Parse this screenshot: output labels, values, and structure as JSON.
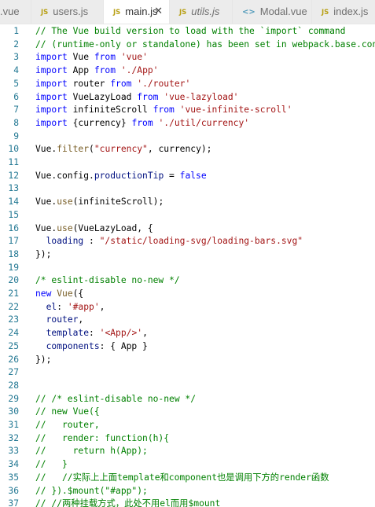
{
  "tabs": [
    {
      "label": ".vue",
      "icon": "vue",
      "active": false
    },
    {
      "label": "users.js",
      "icon": "JS",
      "active": false
    },
    {
      "label": "main.js",
      "icon": "JS",
      "active": true
    },
    {
      "label": "utils.js",
      "icon": "JS",
      "active": false
    },
    {
      "label": "Modal.vue",
      "icon": "vue",
      "active": false
    },
    {
      "label": "index.js",
      "icon": "JS",
      "active": false
    }
  ],
  "editor": {
    "lines": [
      {
        "n": "1",
        "tokens": [
          {
            "t": "// The Vue build version to load with the `import` command",
            "c": "com"
          }
        ]
      },
      {
        "n": "2",
        "tokens": [
          {
            "t": "// (runtime-only or standalone) has been set in webpack.base.conf with an alias.",
            "c": "com"
          }
        ]
      },
      {
        "n": "3",
        "tokens": [
          {
            "t": "import",
            "c": "kw"
          },
          {
            "t": " Vue "
          },
          {
            "t": "from",
            "c": "kw"
          },
          {
            "t": " "
          },
          {
            "t": "'vue'",
            "c": "str"
          }
        ]
      },
      {
        "n": "4",
        "tokens": [
          {
            "t": "import",
            "c": "kw"
          },
          {
            "t": " App "
          },
          {
            "t": "from",
            "c": "kw"
          },
          {
            "t": " "
          },
          {
            "t": "'./App'",
            "c": "str"
          }
        ]
      },
      {
        "n": "5",
        "tokens": [
          {
            "t": "import",
            "c": "kw"
          },
          {
            "t": " router "
          },
          {
            "t": "from",
            "c": "kw"
          },
          {
            "t": " "
          },
          {
            "t": "'./router'",
            "c": "str"
          }
        ]
      },
      {
        "n": "6",
        "tokens": [
          {
            "t": "import",
            "c": "kw"
          },
          {
            "t": " VueLazyLoad "
          },
          {
            "t": "from",
            "c": "kw"
          },
          {
            "t": " "
          },
          {
            "t": "'vue-lazyload'",
            "c": "str"
          }
        ]
      },
      {
        "n": "7",
        "tokens": [
          {
            "t": "import",
            "c": "kw"
          },
          {
            "t": " infiniteScroll "
          },
          {
            "t": "from",
            "c": "kw"
          },
          {
            "t": " "
          },
          {
            "t": "'vue-infinite-scroll'",
            "c": "str"
          }
        ]
      },
      {
        "n": "8",
        "tokens": [
          {
            "t": "import",
            "c": "kw"
          },
          {
            "t": " {currency} "
          },
          {
            "t": "from",
            "c": "kw"
          },
          {
            "t": " "
          },
          {
            "t": "'./util/currency'",
            "c": "str"
          }
        ]
      },
      {
        "n": "9",
        "tokens": []
      },
      {
        "n": "10",
        "tokens": [
          {
            "t": "Vue."
          },
          {
            "t": "filter",
            "c": "fn"
          },
          {
            "t": "("
          },
          {
            "t": "\"currency\"",
            "c": "str"
          },
          {
            "t": ", currency);"
          }
        ]
      },
      {
        "n": "11",
        "tokens": []
      },
      {
        "n": "12",
        "tokens": [
          {
            "t": "Vue.config."
          },
          {
            "t": "productionTip",
            "c": "prop"
          },
          {
            "t": " = "
          },
          {
            "t": "false",
            "c": "kw"
          }
        ]
      },
      {
        "n": "13",
        "tokens": []
      },
      {
        "n": "14",
        "tokens": [
          {
            "t": "Vue."
          },
          {
            "t": "use",
            "c": "fn"
          },
          {
            "t": "(infiniteScroll);"
          }
        ]
      },
      {
        "n": "15",
        "tokens": []
      },
      {
        "n": "16",
        "tokens": [
          {
            "t": "Vue."
          },
          {
            "t": "use",
            "c": "fn"
          },
          {
            "t": "(VueLazyLoad, {"
          }
        ]
      },
      {
        "n": "17",
        "tokens": [
          {
            "t": "  "
          },
          {
            "t": "loading",
            "c": "prop"
          },
          {
            "t": " : "
          },
          {
            "t": "\"/static/loading-svg/loading-bars.svg\"",
            "c": "str"
          }
        ]
      },
      {
        "n": "18",
        "tokens": [
          {
            "t": "});"
          }
        ]
      },
      {
        "n": "19",
        "tokens": []
      },
      {
        "n": "20",
        "tokens": [
          {
            "t": "/* eslint-disable no-new */",
            "c": "com"
          }
        ]
      },
      {
        "n": "21",
        "tokens": [
          {
            "t": "new",
            "c": "kw"
          },
          {
            "t": " "
          },
          {
            "t": "Vue",
            "c": "fn"
          },
          {
            "t": "({"
          }
        ]
      },
      {
        "n": "22",
        "tokens": [
          {
            "t": "  "
          },
          {
            "t": "el",
            "c": "prop"
          },
          {
            "t": ": "
          },
          {
            "t": "'#app'",
            "c": "str"
          },
          {
            "t": ","
          }
        ]
      },
      {
        "n": "23",
        "tokens": [
          {
            "t": "  "
          },
          {
            "t": "router",
            "c": "prop"
          },
          {
            "t": ","
          }
        ]
      },
      {
        "n": "24",
        "tokens": [
          {
            "t": "  "
          },
          {
            "t": "template",
            "c": "prop"
          },
          {
            "t": ": "
          },
          {
            "t": "'<App/>'",
            "c": "str"
          },
          {
            "t": ","
          }
        ]
      },
      {
        "n": "25",
        "tokens": [
          {
            "t": "  "
          },
          {
            "t": "components",
            "c": "prop"
          },
          {
            "t": ": { App }"
          }
        ]
      },
      {
        "n": "26",
        "tokens": [
          {
            "t": "});"
          }
        ]
      },
      {
        "n": "27",
        "tokens": []
      },
      {
        "n": "28",
        "tokens": []
      },
      {
        "n": "29",
        "tokens": [
          {
            "t": "// /* eslint-disable no-new */",
            "c": "com"
          }
        ]
      },
      {
        "n": "30",
        "tokens": [
          {
            "t": "// new Vue({",
            "c": "com"
          }
        ]
      },
      {
        "n": "31",
        "tokens": [
          {
            "t": "//   router,",
            "c": "com"
          }
        ]
      },
      {
        "n": "32",
        "tokens": [
          {
            "t": "//   render: function(h){",
            "c": "com"
          }
        ]
      },
      {
        "n": "33",
        "tokens": [
          {
            "t": "//     return h(App);",
            "c": "com"
          }
        ]
      },
      {
        "n": "34",
        "tokens": [
          {
            "t": "//   }",
            "c": "com"
          }
        ]
      },
      {
        "n": "35",
        "tokens": [
          {
            "t": "//   //实际上上面template和component也是调用下方的render函数",
            "c": "com"
          }
        ]
      },
      {
        "n": "36",
        "tokens": [
          {
            "t": "// }).$mount(\"#app\");",
            "c": "com"
          }
        ]
      },
      {
        "n": "37",
        "tokens": [
          {
            "t": "// //两种挂载方式，此处不用el而用$mount",
            "c": "com"
          }
        ]
      }
    ]
  }
}
